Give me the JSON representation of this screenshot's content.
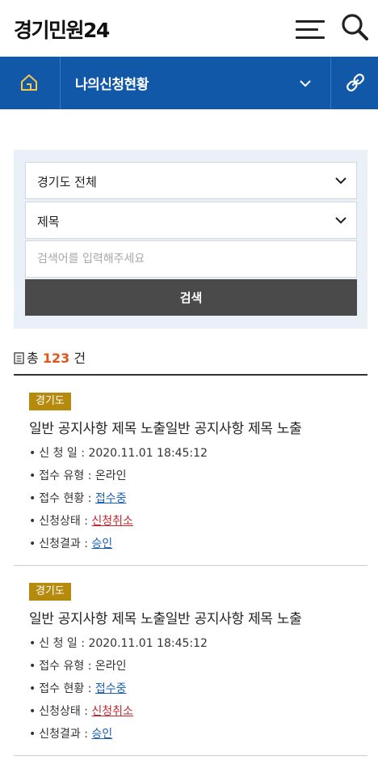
{
  "header": {
    "logo": "경기민원24",
    "menu_icon": "hamburger-icon",
    "search_icon": "search-icon"
  },
  "nav": {
    "title": "나의신청현황",
    "home_icon": "home-icon",
    "dropdown_icon": "chevron-down-icon",
    "link_icon": "link-icon"
  },
  "search": {
    "region_selected": "경기도 전체",
    "field_selected": "제목",
    "placeholder": "검색어를 입력해주세요",
    "button_label": "검색"
  },
  "summary": {
    "prefix": "총",
    "count": "123",
    "suffix": "건"
  },
  "items": [
    {
      "badge": "경기도",
      "title": "일반 공지사항 제목 노출일반 공지사항 제목 노출",
      "date_label": "신 청 일",
      "date_value": "2020.11.01  18:45:12",
      "type_label": "접수 유형",
      "type_value": "온라인",
      "receipt_label": "접수 현황",
      "receipt_value": "접수중",
      "status_label": "신청상태",
      "status_value": "신청취소",
      "result_label": "신청결과",
      "result_value": "승인"
    },
    {
      "badge": "경기도",
      "title": "일반 공지사항 제목 노출일반 공지사항 제목 노출",
      "date_label": "신 청 일",
      "date_value": "2020.11.01  18:45:12",
      "type_label": "접수 유형",
      "type_value": "온라인",
      "receipt_label": "접수 현황",
      "receipt_value": "접수중",
      "status_label": "신청상태",
      "status_value": "신청취소",
      "result_label": "신청결과",
      "result_value": "승인"
    }
  ],
  "colors": {
    "nav_blue": "#1159a8",
    "badge_gold": "#b58a0d",
    "count_orange": "#e0561a",
    "link_blue": "#1a5fb4",
    "link_red": "#c0262c"
  }
}
